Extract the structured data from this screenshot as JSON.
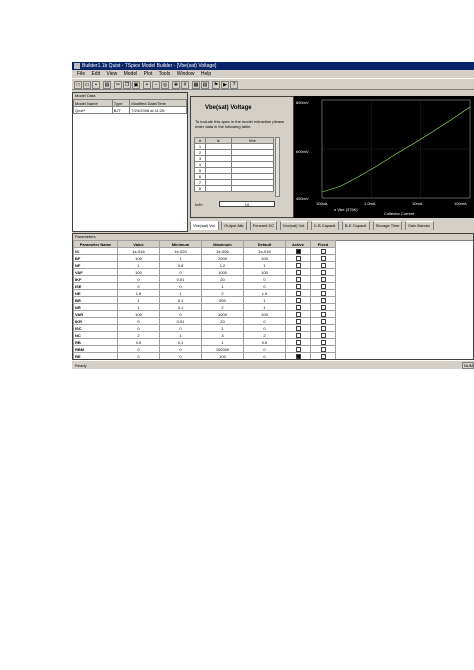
{
  "window": {
    "title": "Builder1.1b Quist - TSpice Model Builder - [Vbe(sat) Voltage]"
  },
  "menu": [
    "File",
    "Edit",
    "View",
    "Model",
    "Plot",
    "Tools",
    "Window",
    "Help"
  ],
  "models_panel": {
    "header": "Model Data",
    "columns": [
      "Model Name",
      "Type",
      "Modified Date/Time"
    ],
    "rows": [
      {
        "name": "Qnxt*",
        "type": "BJT",
        "modified": "7/24/2006 at 11:28"
      }
    ]
  },
  "dialog": {
    "title": "Vbe(sat) Voltage",
    "description": "To include this spec in the model extraction please enter data in the following table.",
    "table": {
      "columns": [
        "#",
        "Ic",
        "Vbe"
      ],
      "rows": [
        "1",
        "2",
        "3",
        "4",
        "5",
        "6",
        "7",
        "8"
      ]
    },
    "ib_label": "Ic/Ib",
    "ib_value": "10"
  },
  "chart_data": {
    "type": "line",
    "title": "",
    "xlabel": "Collector Current",
    "ylabel": "",
    "legend": "o Vbe (375K)",
    "x_ticks": [
      "100uA",
      "1.0mA",
      "10mA",
      "100mA"
    ],
    "y_ticks": [
      "650mV",
      "600mV",
      "450mV"
    ],
    "series": [
      {
        "values": [
          0.06,
          0.12,
          0.22,
          0.33,
          0.45,
          0.56,
          0.68,
          0.8,
          0.93
        ]
      }
    ],
    "grid": true,
    "line_color": "#7fd04a"
  },
  "tabs": [
    "Vbe(sat) Vol.",
    "Output Attr.",
    "Forward DC",
    "Vce(sat) Vol.",
    "C-B Capacit.",
    "B-E Capacit.",
    "Storage Time",
    "Gain Bandw."
  ],
  "active_tab": 0,
  "parameters": {
    "header": "Parameters",
    "columns": [
      "Parameter Name",
      "Value",
      "Minimum",
      "Maximum",
      "Default",
      "Active",
      "Fixed"
    ],
    "rows": [
      [
        "IS",
        "1e-016",
        "1e-020",
        "1e-006",
        "1e-016",
        true,
        false
      ],
      [
        "BF",
        "100",
        "1",
        "2000",
        "100",
        false,
        false
      ],
      [
        "NF",
        "1",
        "0.8",
        "1.2",
        "1",
        false,
        false
      ],
      [
        "VAF",
        "100",
        "0",
        "1000",
        "100",
        false,
        false
      ],
      [
        "IKF",
        "0",
        "0.01",
        "20",
        "0",
        false,
        false
      ],
      [
        "ISE",
        "0",
        "0",
        "1",
        "0",
        false,
        false
      ],
      [
        "NE",
        "1.5",
        "1",
        "2",
        "1.5",
        false,
        false
      ],
      [
        "BR",
        "1",
        "0.1",
        "500",
        "1",
        false,
        false
      ],
      [
        "NR",
        "1",
        "0.1",
        "2",
        "1",
        false,
        false
      ],
      [
        "VAR",
        "100",
        "0",
        "1000",
        "100",
        false,
        false
      ],
      [
        "IKR",
        "0",
        "0.01",
        "20",
        "0",
        false,
        false
      ],
      [
        "ISC",
        "0",
        "0",
        "1",
        "0",
        false,
        false
      ],
      [
        "NC",
        "2",
        "1",
        "3",
        "2",
        false,
        false
      ],
      [
        "RB",
        "0.5",
        "0.1",
        "1",
        "0.5",
        false,
        false
      ],
      [
        "RBM",
        "0",
        "0",
        "100000",
        "0",
        false,
        false
      ],
      [
        "RE",
        "0",
        "0",
        "100",
        "0",
        true,
        false
      ],
      [
        "RC",
        "0",
        "0",
        "100000",
        "0",
        false,
        false
      ]
    ]
  },
  "statusbar": {
    "text": "Ready",
    "right": "NUM"
  }
}
